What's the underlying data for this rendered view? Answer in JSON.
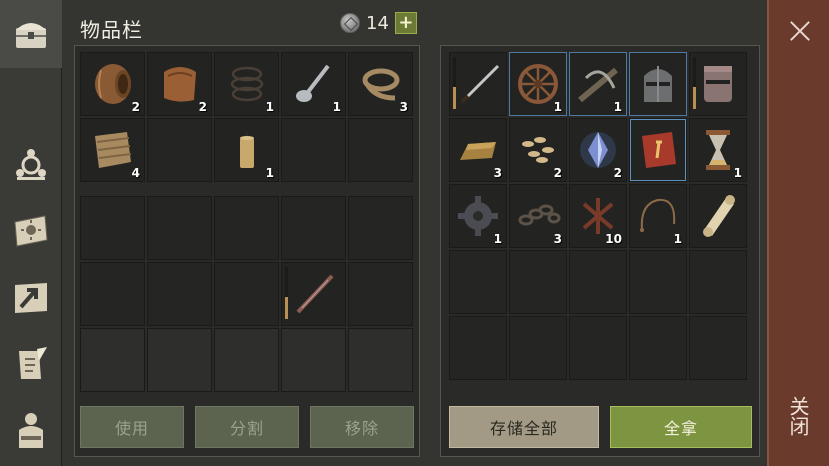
{
  "header": {
    "title": "物品栏",
    "currency": "14",
    "add_label": "+"
  },
  "sidebar": {
    "items": [
      {
        "name": "sidebar-item-inventory",
        "icon": "chest-icon"
      },
      {
        "name": "sidebar-item-skills",
        "icon": "emblem-icon"
      },
      {
        "name": "sidebar-item-recipes",
        "icon": "sun-book-icon"
      },
      {
        "name": "sidebar-item-map",
        "icon": "map-arrow-icon"
      },
      {
        "name": "sidebar-item-quests",
        "icon": "scroll-quill-icon"
      },
      {
        "name": "sidebar-item-character",
        "icon": "body-icon"
      }
    ]
  },
  "inventory": {
    "top_rows": [
      [
        {
          "icon": "barrel-icon",
          "count": "2"
        },
        {
          "icon": "leather-icon",
          "count": "2"
        },
        {
          "icon": "rope-coil-icon",
          "count": "1"
        },
        {
          "icon": "spoon-icon",
          "count": "1"
        },
        {
          "icon": "thick-rope-icon",
          "count": "3"
        }
      ],
      [
        {
          "icon": "cloth-icon",
          "count": "4"
        },
        {
          "icon": "",
          "count": ""
        },
        {
          "icon": "candle-icon",
          "count": "1"
        },
        {
          "icon": "",
          "count": ""
        },
        {
          "icon": "",
          "count": ""
        }
      ]
    ],
    "equip_rows": 3,
    "sword_label": ""
  },
  "storage": {
    "rows": [
      [
        {
          "icon": "sword-icon",
          "count": "",
          "bar": true
        },
        {
          "icon": "wheel-icon",
          "count": "1",
          "sel": true
        },
        {
          "icon": "crossbow-icon",
          "count": "1",
          "sel": true
        },
        {
          "icon": "helmet-icon",
          "count": "",
          "sel": true
        },
        {
          "icon": "great-helm-icon",
          "count": "",
          "bar": true
        }
      ],
      [
        {
          "icon": "ingot-icon",
          "count": "3"
        },
        {
          "icon": "seeds-icon",
          "count": "2"
        },
        {
          "icon": "crystal-icon",
          "count": "2"
        },
        {
          "icon": "red-book-icon",
          "count": "",
          "sel": true
        },
        {
          "icon": "hourglass-icon",
          "count": "1"
        }
      ],
      [
        {
          "icon": "gear-icon",
          "count": "1"
        },
        {
          "icon": "chain-icon",
          "count": "3"
        },
        {
          "icon": "straps-icon",
          "count": "10"
        },
        {
          "icon": "wire-icon",
          "count": "1"
        },
        {
          "icon": "scroll-icon",
          "count": ""
        }
      ]
    ]
  },
  "buttons": {
    "use": "使用",
    "split": "分割",
    "remove": "移除",
    "store_all": "存储全部",
    "take_all": "全拿"
  },
  "close": {
    "label": "关闭"
  },
  "colors": {
    "accent_green": "#7d9440",
    "close_red": "#6a3a2c"
  }
}
